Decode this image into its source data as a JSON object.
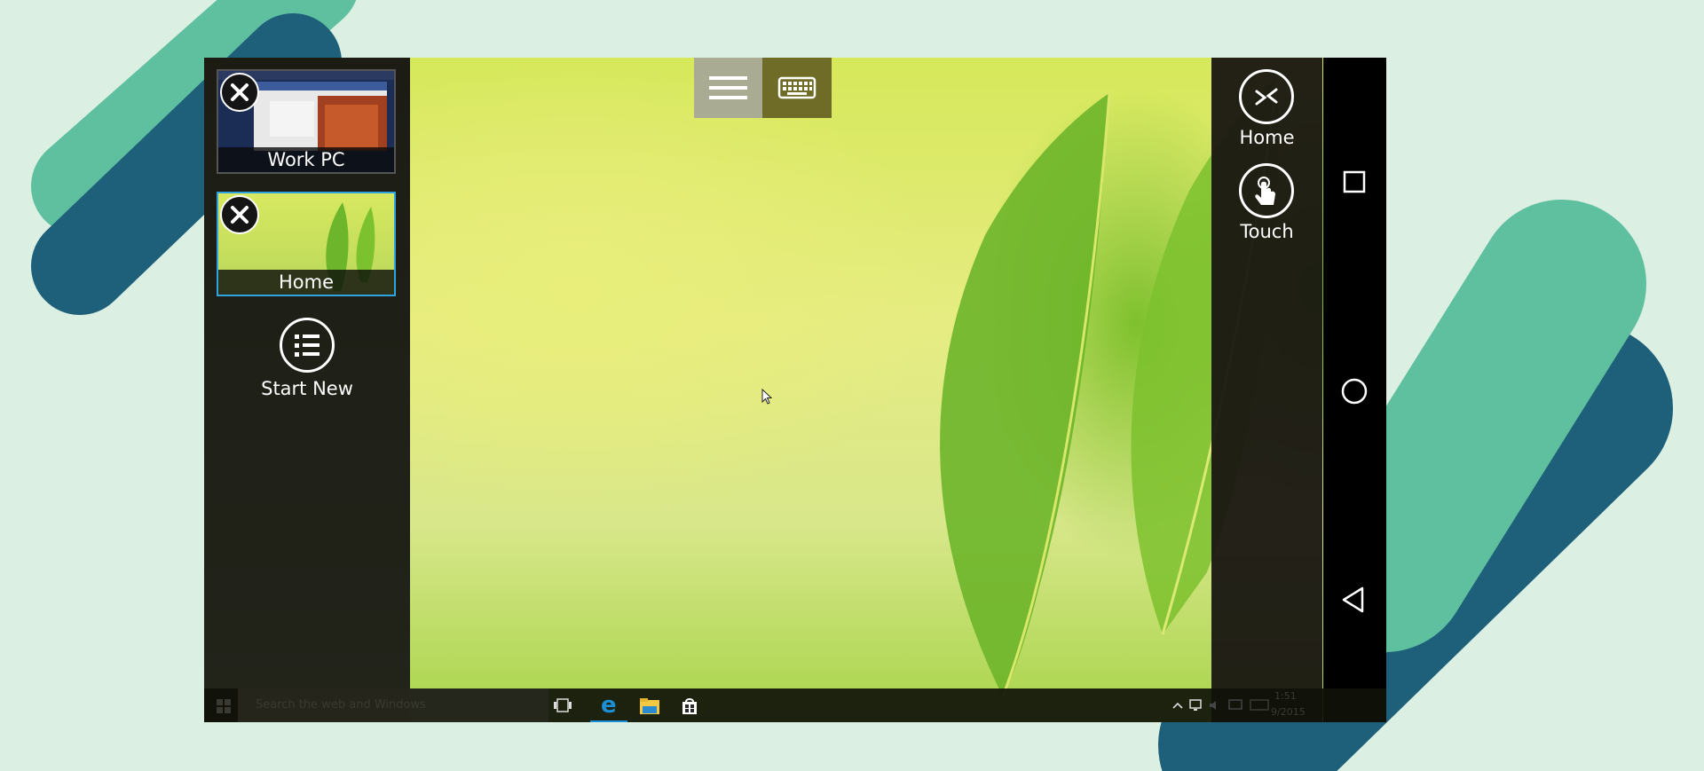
{
  "sessions": [
    {
      "label": "Work PC",
      "active": false
    },
    {
      "label": "Home",
      "active": true
    }
  ],
  "start_new": {
    "label": "Start New"
  },
  "right_actions": {
    "home_label": "Home",
    "touch_label": "Touch"
  },
  "taskbar": {
    "search_placeholder": "Search the web and Windows",
    "clock_time": "1:51",
    "clock_date": "9/2015"
  },
  "colors": {
    "background": "#dbefe2",
    "teal_light": "#5fc0a0",
    "teal_dark": "#1e5f7a",
    "active_border": "#2ea3e0",
    "edge_blue": "#1a8fd6"
  },
  "icons": {
    "close": "close-icon",
    "start_new": "list-icon",
    "home_action": "remote-desktop-icon",
    "touch": "touch-hand-icon",
    "menu": "hamburger-icon",
    "keyboard": "keyboard-icon",
    "recents": "square-icon",
    "android_home": "circle-icon",
    "back": "triangle-back-icon"
  }
}
